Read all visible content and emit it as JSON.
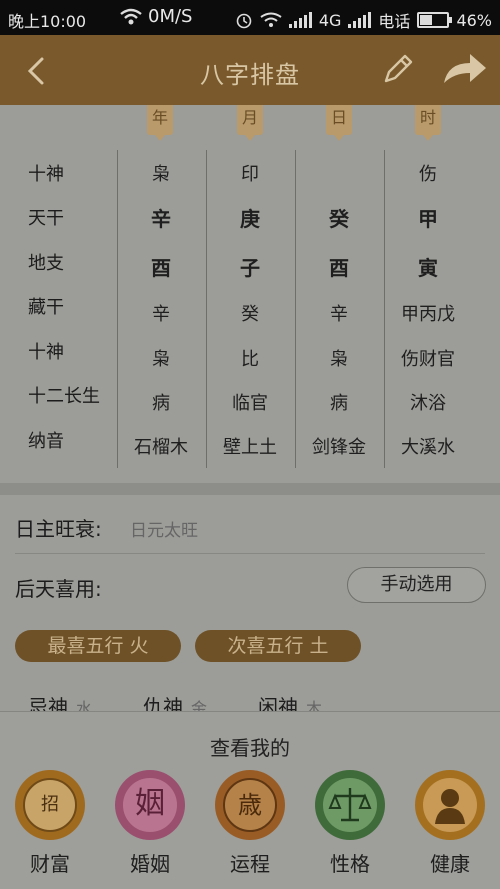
{
  "status": {
    "time": "晚上10:00",
    "speed": "0M/S",
    "network": "4G",
    "carrier": "电话",
    "battery": "46%"
  },
  "header": {
    "title": "八字排盘"
  },
  "pillars": [
    "年",
    "月",
    "日",
    "时"
  ],
  "row_labels": [
    "十神",
    "天干",
    "地支",
    "藏干",
    "十神",
    "十二长生",
    "纳音"
  ],
  "table": [
    [
      "枭",
      "印",
      "",
      "伤"
    ],
    [
      "辛",
      "庚",
      "癸",
      "甲"
    ],
    [
      "酉",
      "子",
      "酉",
      "寅"
    ],
    [
      "辛",
      "癸",
      "辛",
      "甲丙戊"
    ],
    [
      "枭",
      "比",
      "枭",
      "伤财官"
    ],
    [
      "病",
      "临官",
      "病",
      "沐浴"
    ],
    [
      "石榴木",
      "壁上土",
      "剑锋金",
      "大溪水"
    ]
  ],
  "info": {
    "strength_label": "日主旺衰:",
    "strength_value": "日元太旺",
    "favor_label": "后天喜用:",
    "manual_button": "手动选用",
    "best_element": "最喜五行  火",
    "second_element": "次喜五行  土",
    "gods": [
      {
        "label": "忌神",
        "value": "水"
      },
      {
        "label": "仇神",
        "value": "金"
      },
      {
        "label": "闲神",
        "value": "木"
      }
    ]
  },
  "sheet": {
    "title": "查看我的",
    "items": [
      "财富",
      "婚姻",
      "运程",
      "性格",
      "健康"
    ],
    "icon_glyphs": [
      "招",
      "姻",
      "歳",
      "",
      ""
    ]
  },
  "colors": {
    "brand": "#7a5a2c",
    "pill": "#6e5127"
  }
}
